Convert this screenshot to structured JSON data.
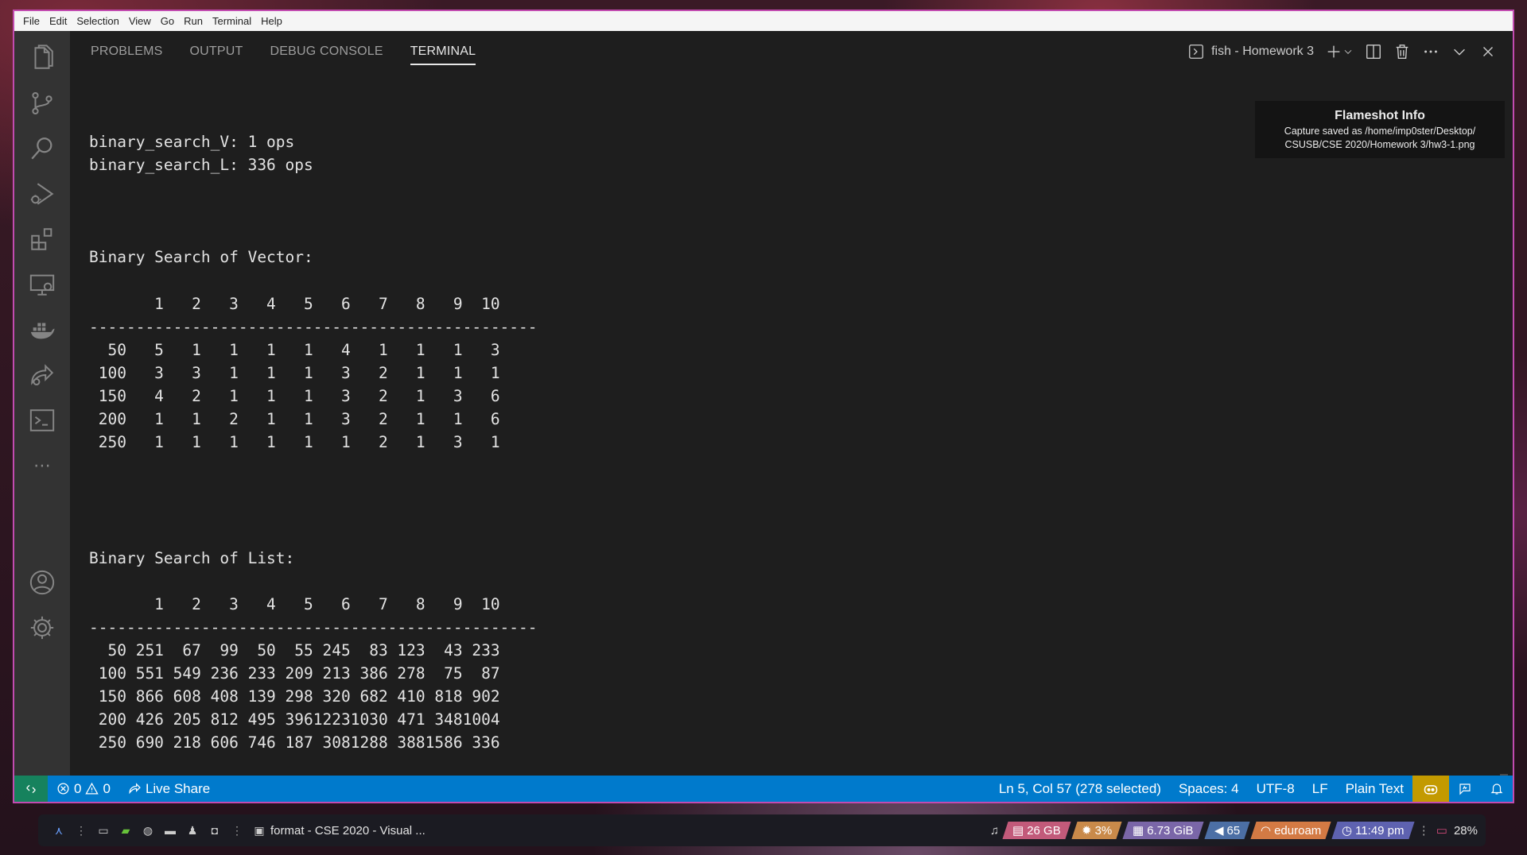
{
  "menu": [
    "File",
    "Edit",
    "Selection",
    "View",
    "Go",
    "Run",
    "Terminal",
    "Help"
  ],
  "panel": {
    "tabs": [
      {
        "label": "PROBLEMS"
      },
      {
        "label": "OUTPUT"
      },
      {
        "label": "DEBUG CONSOLE"
      },
      {
        "label": "TERMINAL",
        "active": true
      }
    ],
    "terminal_name": "fish - Homework 3"
  },
  "terminal": {
    "lines": [
      "binary_search_V: 1 ops",
      "binary_search_L: 336 ops",
      "",
      "",
      "",
      "Binary Search of Vector:",
      "",
      "       1   2   3   4   5   6   7   8   9  10",
      "------------------------------------------------",
      "  50   5   1   1   1   1   4   1   1   1   3",
      " 100   3   3   1   1   1   3   2   1   1   1",
      " 150   4   2   1   1   1   3   2   1   3   6",
      " 200   1   1   2   1   1   3   2   1   1   6",
      " 250   1   1   1   1   1   1   2   1   3   1",
      "",
      "",
      "",
      "",
      "Binary Search of List:",
      "",
      "       1   2   3   4   5   6   7   8   9  10",
      "------------------------------------------------",
      "  50 251  67  99  50  55 245  83 123  43 233",
      " 100 551 549 236 233 209 213 386 278  75  87",
      " 150 866 608 408 139 298 320 682 410 818 902",
      " 200 426 205 812 495 39612231030 471 3481004",
      " 250 690 218 606 746 187 3081288 3881586 336"
    ]
  },
  "toast": {
    "title": "Flameshot Info",
    "body_line1": "Capture saved as /home/imp0ster/Desktop/",
    "body_line2": "CSUSB/CSE 2020/Homework 3/hw3-1.png"
  },
  "statusbar": {
    "errors": "0",
    "warnings": "0",
    "live_share": "Live Share",
    "position": "Ln 5, Col 57 (278 selected)",
    "spaces": "Spaces: 4",
    "encoding": "UTF-8",
    "eol": "LF",
    "language": "Plain Text"
  },
  "taskbar": {
    "window_title": "format - CSE 2020 - Visual ...",
    "disk": "26 GB",
    "cpu": "3%",
    "memory": "6.73 GiB",
    "volume": "65",
    "network": "eduroam",
    "time": "11:49 pm",
    "battery": "28%"
  },
  "colors": {
    "statusbar": "#007acc",
    "remote": "#16825d",
    "window_border": "#c24bb0",
    "panel_bg": "#1e1e1e",
    "activitybar": "#333333"
  }
}
